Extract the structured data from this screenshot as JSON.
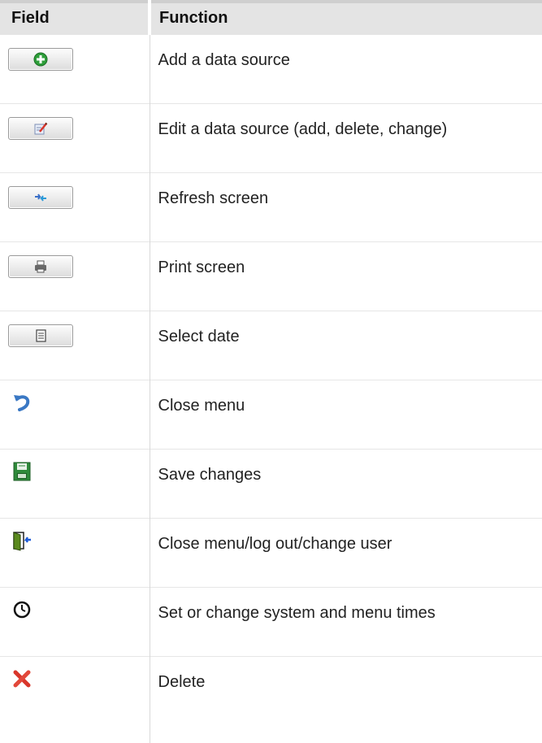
{
  "header": {
    "field": "Field",
    "function": "Function"
  },
  "rows": [
    {
      "icon": "add-plus-icon",
      "function": "Add a data source"
    },
    {
      "icon": "edit-pencil-icon",
      "function": "Edit a data source (add, delete, change)"
    },
    {
      "icon": "refresh-arrows-icon",
      "function": "Refresh screen"
    },
    {
      "icon": "printer-icon",
      "function": "Print screen"
    },
    {
      "icon": "calendar-document-icon",
      "function": "Select date"
    },
    {
      "icon": "undo-arrow-icon",
      "function": "Close menu"
    },
    {
      "icon": "floppy-save-icon",
      "function": "Save changes"
    },
    {
      "icon": "exit-door-icon",
      "function": "Close menu/log out/change user"
    },
    {
      "icon": "clock-icon",
      "function": "Set or change system and menu times"
    },
    {
      "icon": "red-x-delete-icon",
      "function": "Delete"
    }
  ]
}
